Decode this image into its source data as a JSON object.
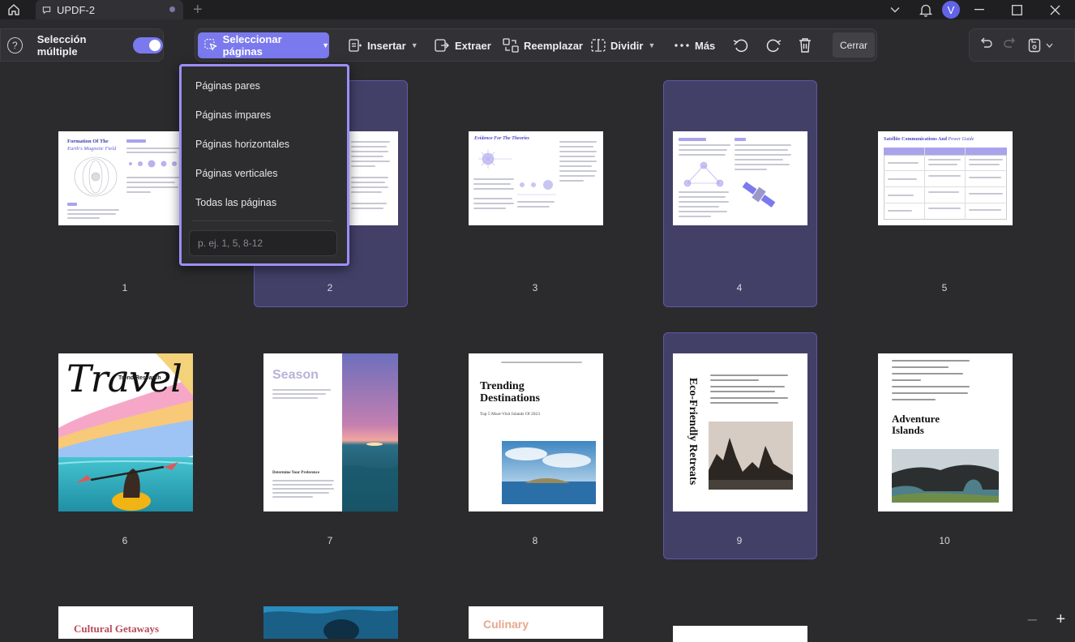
{
  "titlebar": {
    "tab_title": "UPDF-2",
    "add_tab": "+",
    "avatar_initial": "V"
  },
  "toolbar": {
    "multi_select_label": "Selección múltiple",
    "select_pages_label": "Seleccionar páginas",
    "insert_label": "Insertar",
    "extract_label": "Extraer",
    "replace_label": "Reemplazar",
    "split_label": "Dividir",
    "more_label": "Más",
    "close_label": "Cerrar",
    "accent_color": "#7b79ee"
  },
  "dropdown": {
    "items": [
      "Páginas pares",
      "Páginas impares",
      "Páginas horizontales",
      "Páginas verticales",
      "Todas las páginas"
    ],
    "range_placeholder": "p. ej. 1, 5, 8-12"
  },
  "pages": [
    {
      "number": "1",
      "selected": false,
      "title": "Formation Of The",
      "subtitle": "Earth's Magnetic Field"
    },
    {
      "number": "2",
      "selected": true,
      "title": "",
      "subtitle": ""
    },
    {
      "number": "3",
      "selected": false,
      "title": "Evidence For The Theories",
      "subtitle": ""
    },
    {
      "number": "4",
      "selected": true,
      "title": "",
      "subtitle": ""
    },
    {
      "number": "5",
      "selected": false,
      "title": "Satellite Communications And",
      "subtitle": "Power Guide"
    },
    {
      "number": "6",
      "selected": false,
      "title": "Travel",
      "subtitle": "Trend Research"
    },
    {
      "number": "7",
      "selected": false,
      "title": "Season",
      "subtitle": "Determine Your Preference"
    },
    {
      "number": "8",
      "selected": false,
      "title": "Trending Destinations",
      "subtitle": "Top 5 Must-Visit Islands Of 2023"
    },
    {
      "number": "9",
      "selected": true,
      "title": "Eco-Friendly Retreats",
      "subtitle": ""
    },
    {
      "number": "10",
      "selected": false,
      "title": "Adventure Islands",
      "subtitle": ""
    },
    {
      "number": "",
      "selected": false,
      "title": "Cultural Getaways",
      "subtitle": ""
    },
    {
      "number": "",
      "selected": false,
      "title": "",
      "subtitle": ""
    },
    {
      "number": "",
      "selected": false,
      "title": "Culinary",
      "subtitle": ""
    },
    {
      "number": "",
      "selected": false,
      "title": "",
      "subtitle": ""
    }
  ],
  "zoom": {
    "minus": "–",
    "plus": "+"
  }
}
